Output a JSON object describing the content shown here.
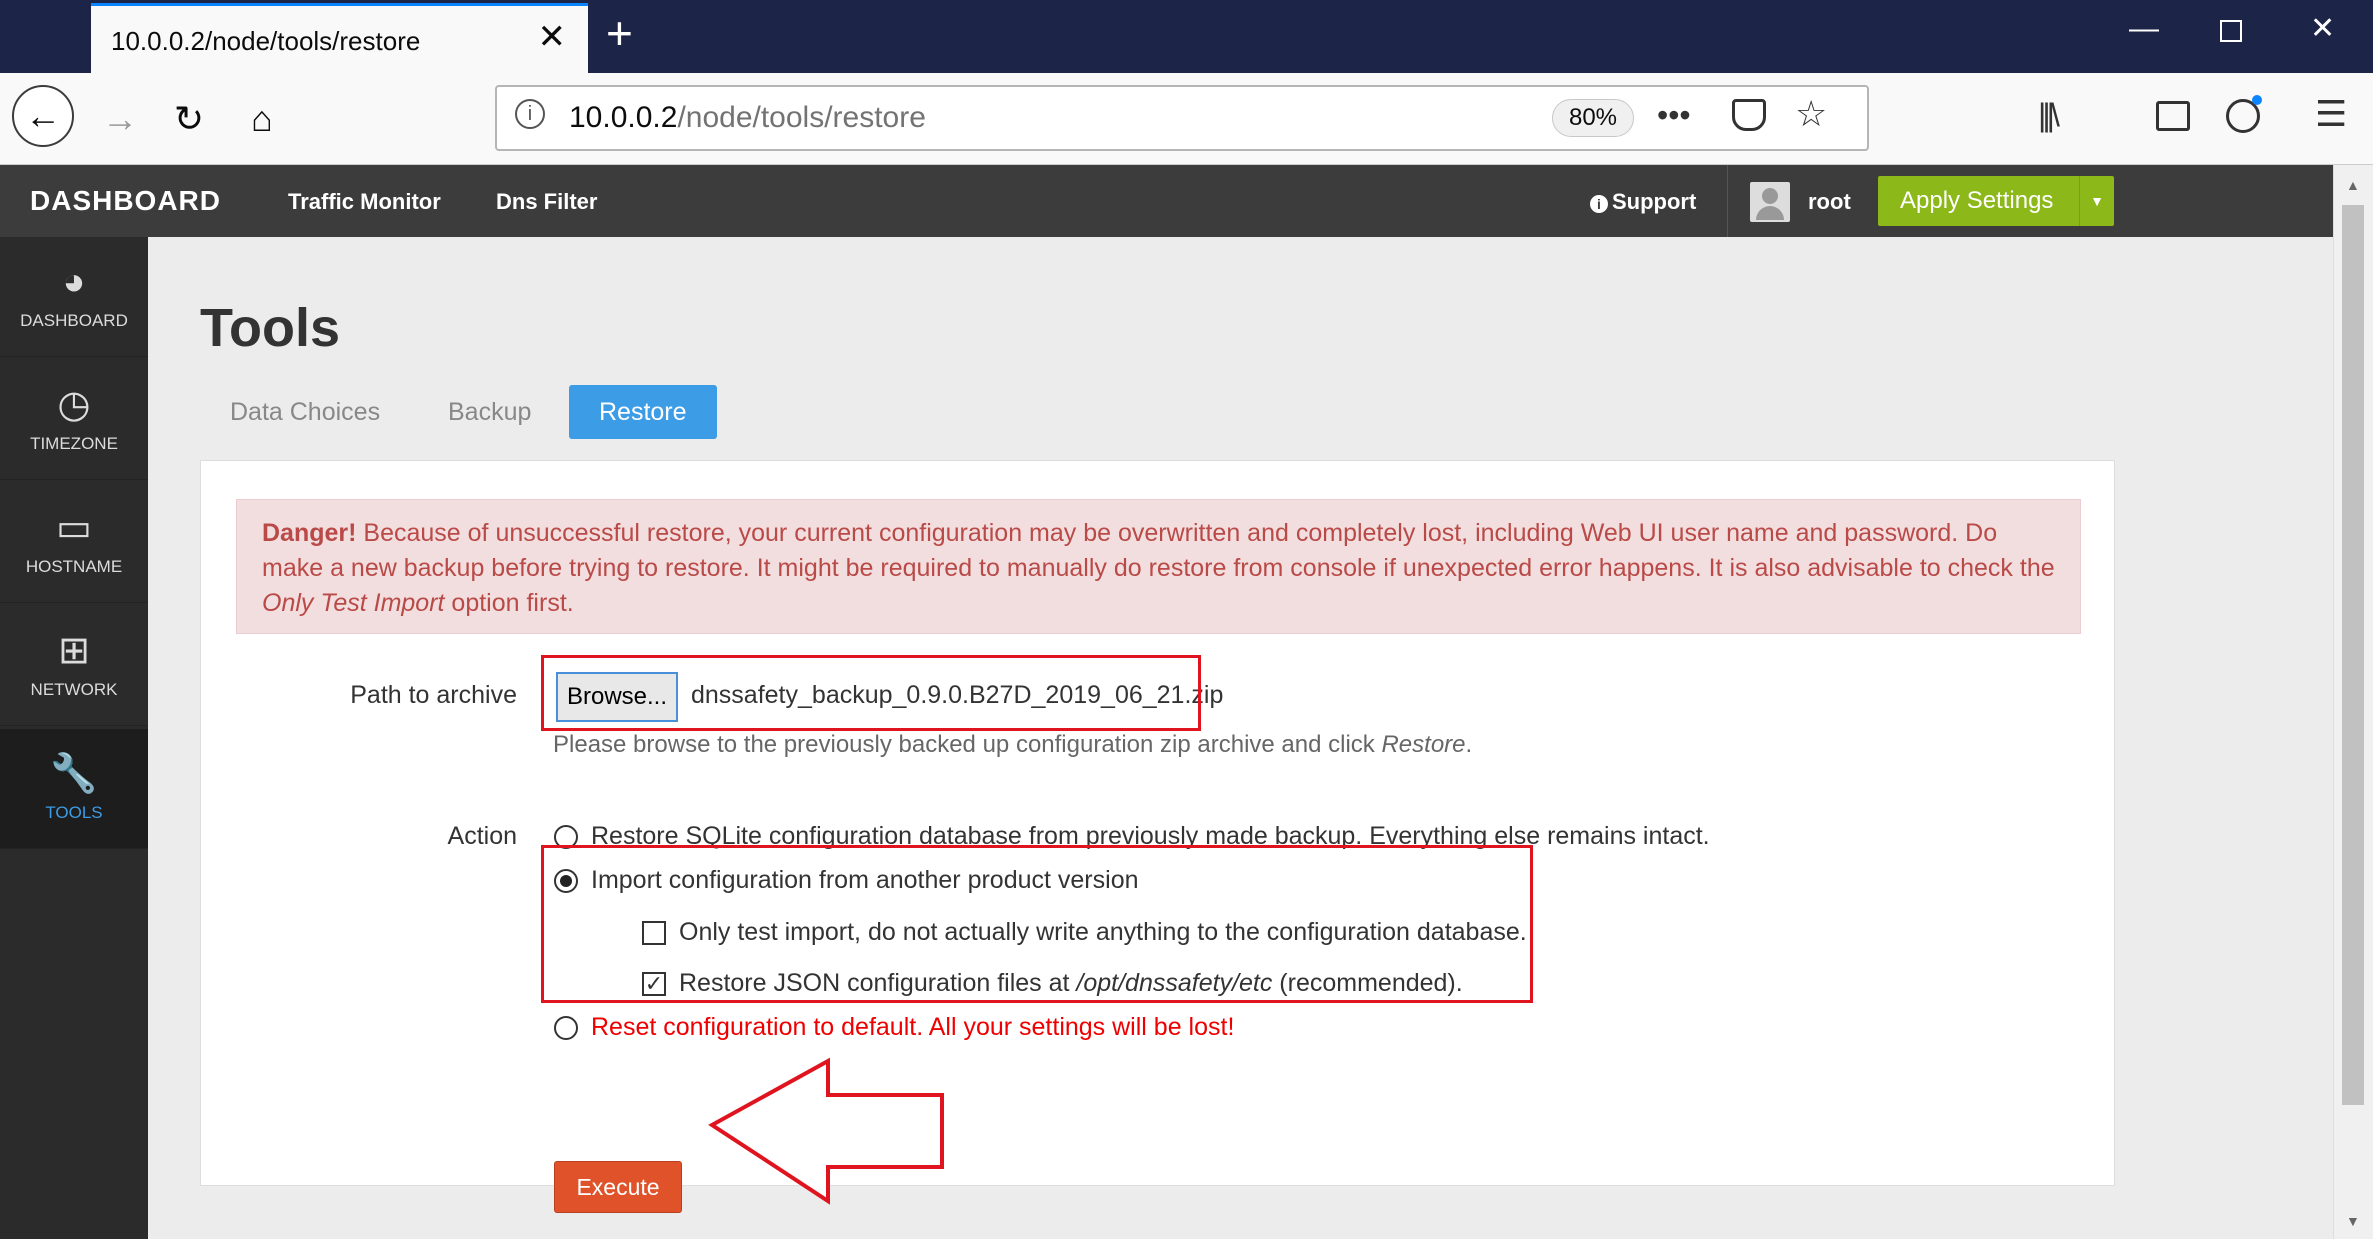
{
  "browser": {
    "tab_title": "10.0.0.2/node/tools/restore",
    "url_host": "10.0.0.2",
    "url_path": "/node/tools/restore",
    "zoom": "80%"
  },
  "header": {
    "brand": "DASHBOARD",
    "nav": [
      "Traffic Monitor",
      "Dns Filter"
    ],
    "support": "Support",
    "user": "root",
    "apply_settings": "Apply Settings"
  },
  "sidebar": {
    "items": [
      {
        "label": "DASHBOARD",
        "icon": "speedometer-icon"
      },
      {
        "label": "TIMEZONE",
        "icon": "clock-icon"
      },
      {
        "label": "HOSTNAME",
        "icon": "hdd-icon"
      },
      {
        "label": "NETWORK",
        "icon": "sitemap-icon"
      },
      {
        "label": "TOOLS",
        "icon": "wrench-icon",
        "active": true
      }
    ]
  },
  "page": {
    "title": "Tools",
    "tabs": [
      "Data Choices",
      "Backup",
      "Restore"
    ],
    "active_tab": "Restore"
  },
  "alert": {
    "strong": "Danger!",
    "text_1": " Because of unsuccessful restore, your current configuration may be overwritten and completely lost, including Web UI user name and password. Do make a new backup before trying to restore. It might be required to manually do restore from console if unexpected error happens. It is also advisable to check the ",
    "emphasis": "Only Test Import",
    "text_2": " option first."
  },
  "form": {
    "path_label": "Path to archive",
    "browse_label": "Browse...",
    "file_name": "dnssafety_backup_0.9.0.B27D_2019_06_21.zip",
    "help_1": "Please browse to the previously backed up configuration zip archive and click ",
    "help_em": "Restore",
    "help_2": ".",
    "action_label": "Action",
    "options": [
      {
        "text": "Restore SQLite configuration database from previously made backup. Everything else remains intact.",
        "selected": false
      },
      {
        "text": "Import configuration from another product version",
        "selected": true
      },
      {
        "text": "Reset configuration to default. All your settings will be lost!",
        "selected": false
      }
    ],
    "checkboxes": [
      {
        "text": "Only test import, do not actually write anything to the configuration database.",
        "checked": false
      },
      {
        "text_1": "Restore JSON configuration files at ",
        "em": "/opt/dnssafety/etc",
        "text_2": " (recommended).",
        "checked": true
      }
    ],
    "execute_label": "Execute"
  },
  "colors": {
    "accent": "#3c9ce6",
    "apply": "#8cb819",
    "execute": "#e0532a",
    "danger_text": "#b94a48",
    "annotation": "#e0141e"
  }
}
